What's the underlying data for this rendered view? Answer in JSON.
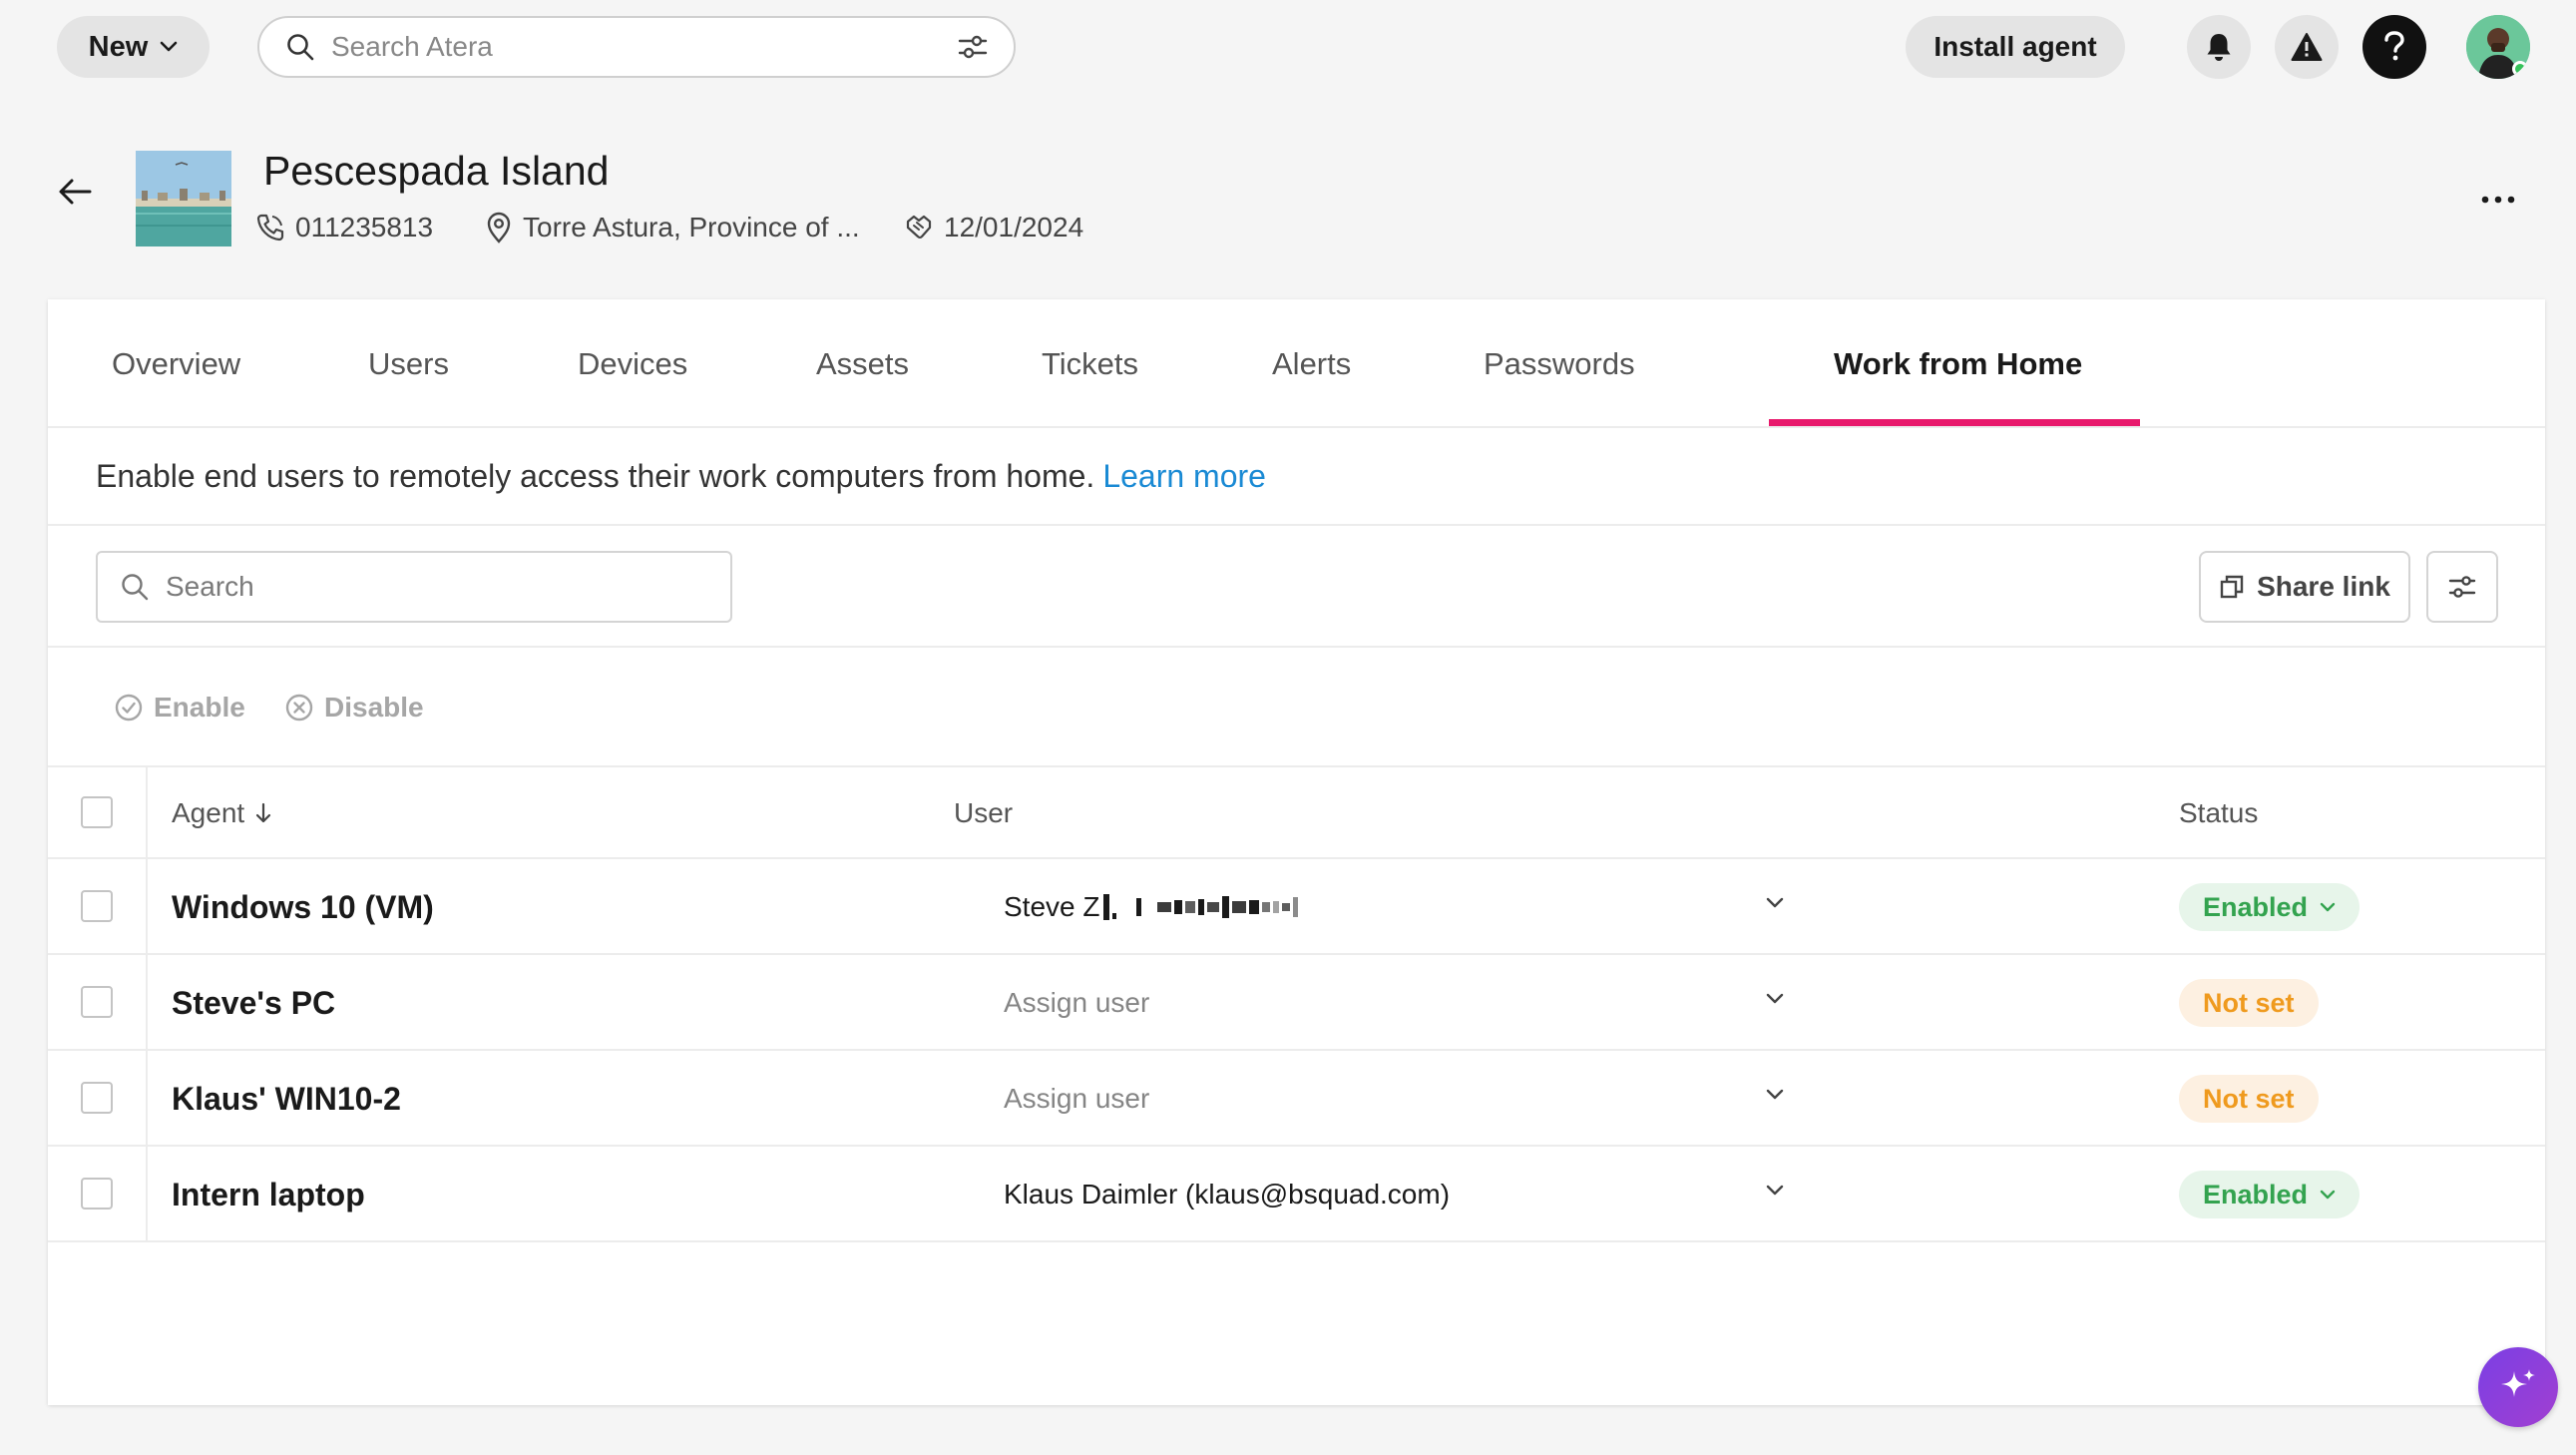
{
  "topbar": {
    "new_label": "New",
    "search_placeholder": "Search Atera",
    "install_label": "Install agent"
  },
  "customer": {
    "name": "Pescespada Island",
    "phone": "011235813",
    "location": "Torre Astura, Province of ...",
    "date": "12/01/2024"
  },
  "tabs": [
    {
      "label": "Overview"
    },
    {
      "label": "Users"
    },
    {
      "label": "Devices"
    },
    {
      "label": "Assets"
    },
    {
      "label": "Tickets"
    },
    {
      "label": "Alerts"
    },
    {
      "label": "Passwords"
    },
    {
      "label": "Work from Home",
      "active": true
    }
  ],
  "info": {
    "text": "Enable end users to remotely access their work computers from home.",
    "link": "Learn more"
  },
  "toolbar": {
    "search_placeholder": "Search",
    "share_label": "Share link"
  },
  "bulk": {
    "enable_label": "Enable",
    "disable_label": "Disable"
  },
  "table": {
    "headers": {
      "agent": "Agent",
      "user": "User",
      "status": "Status"
    },
    "rows": [
      {
        "agent": "Windows 10 (VM)",
        "user": "Steve Z",
        "status": "Enabled"
      },
      {
        "agent": "Steve's PC",
        "user": "Assign user",
        "status": "Not set"
      },
      {
        "agent": "Klaus' WIN10-2",
        "user": "Assign user",
        "status": "Not set"
      },
      {
        "agent": "Intern laptop",
        "user": "Klaus Daimler (klaus@bsquad.com)",
        "status": "Enabled"
      }
    ]
  },
  "colors": {
    "accent_tab": "#e8196c",
    "link": "#1a8ad4",
    "enabled": "#33a34f",
    "not_set": "#ef9a1e"
  }
}
